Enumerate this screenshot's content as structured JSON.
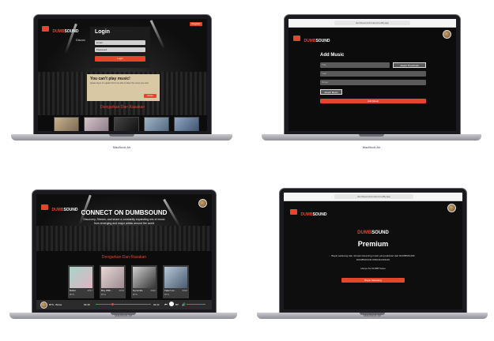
{
  "laptop_model": "MacBook Air",
  "screen1": {
    "brand_prefix": "DUMB",
    "brand_suffix": "SOUND",
    "partial_hero": "Discov",
    "header_button": "Register",
    "login_title": "Login",
    "email_placeholder": "Email",
    "password_placeholder": "Password",
    "login_button": "Login",
    "warning_title": "You can't play music!",
    "warning_text": "please log in or register first to be able to listen the music you want",
    "warning_button": "Close",
    "section_title": "Dengarkan Dan Rasakan"
  },
  "screen2": {
    "url": "dumbsound-frontend.netlify.app",
    "brand_prefix": "DUMB",
    "brand_suffix": "SOUND",
    "page_title": "Add Music",
    "title_placeholder": "Title",
    "attach_thumbnail": "Attach Thumbnail",
    "year_placeholder": "Year",
    "singer_placeholder": "Singer",
    "attach_music": "Attach Music",
    "submit_button": "Add Music"
  },
  "screen3": {
    "brand_prefix": "DUMB",
    "brand_suffix": "SOUND",
    "hero_title": "CONNECT ON DUMBSOUND",
    "hero_sub1": "Discovery, Stream, and share a constantly expanding mix of music",
    "hero_sub2": "from emerging and major artists around the world",
    "section_title": "Dengarkan Dan Rasakan",
    "cards": [
      {
        "title": "Butter",
        "year": "2021",
        "artist": "BTS"
      },
      {
        "title": "Boy With...",
        "year": "2019",
        "artist": "BTS"
      },
      {
        "title": "Dynamite",
        "year": "2020",
        "artist": "BTS"
      },
      {
        "title": "Fake Lov...",
        "year": "2018",
        "artist": "BTS"
      }
    ],
    "player_track": "BTS - Butter",
    "time_current": "00:48",
    "time_total": "02:42",
    "progress": 0.3,
    "volume": 0.75
  },
  "screen4": {
    "url": "dumbsound-frontend.netlify.app",
    "brand_prefix": "DUMB",
    "brand_suffix": "SOUND",
    "premium_title": "Premium",
    "desc1": "Bayar sekarang dan nikmati streaming music yang kekinian dari DUMBSOUND",
    "desc2": "DUMBSOUND 0981312323232",
    "account_label": "Hanya Ke DUMB Sotue",
    "pay_button": "Bayar Sekarang"
  }
}
